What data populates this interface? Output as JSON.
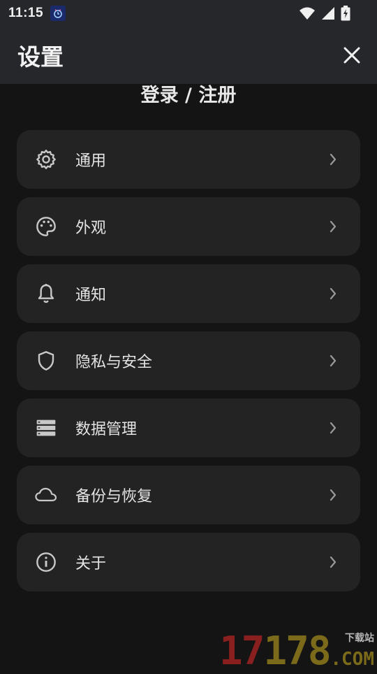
{
  "status_bar": {
    "time": "11:15",
    "notification_icon": "app-notification-icon",
    "icons": [
      "wifi-icon",
      "cell-signal-icon",
      "battery-charging-icon"
    ]
  },
  "header": {
    "title": "设置",
    "close_icon": "close-icon"
  },
  "login": {
    "label": "登录 / 注册"
  },
  "menu": {
    "items": [
      {
        "label": "通用",
        "icon": "gear-icon"
      },
      {
        "label": "外观",
        "icon": "palette-icon"
      },
      {
        "label": "通知",
        "icon": "bell-icon"
      },
      {
        "label": "隐私与安全",
        "icon": "shield-icon"
      },
      {
        "label": "数据管理",
        "icon": "storage-icon"
      },
      {
        "label": "备份与恢复",
        "icon": "cloud-icon"
      },
      {
        "label": "关于",
        "icon": "info-icon"
      }
    ]
  },
  "watermark": {
    "digits_a": "17",
    "digits_b": "178",
    "side_text": "下载站",
    "domain": ".COM"
  },
  "colors": {
    "background": "#141414",
    "header": "#25272b",
    "card": "#232323",
    "text": "#e4e4e4",
    "icon": "#c8c8c8"
  }
}
